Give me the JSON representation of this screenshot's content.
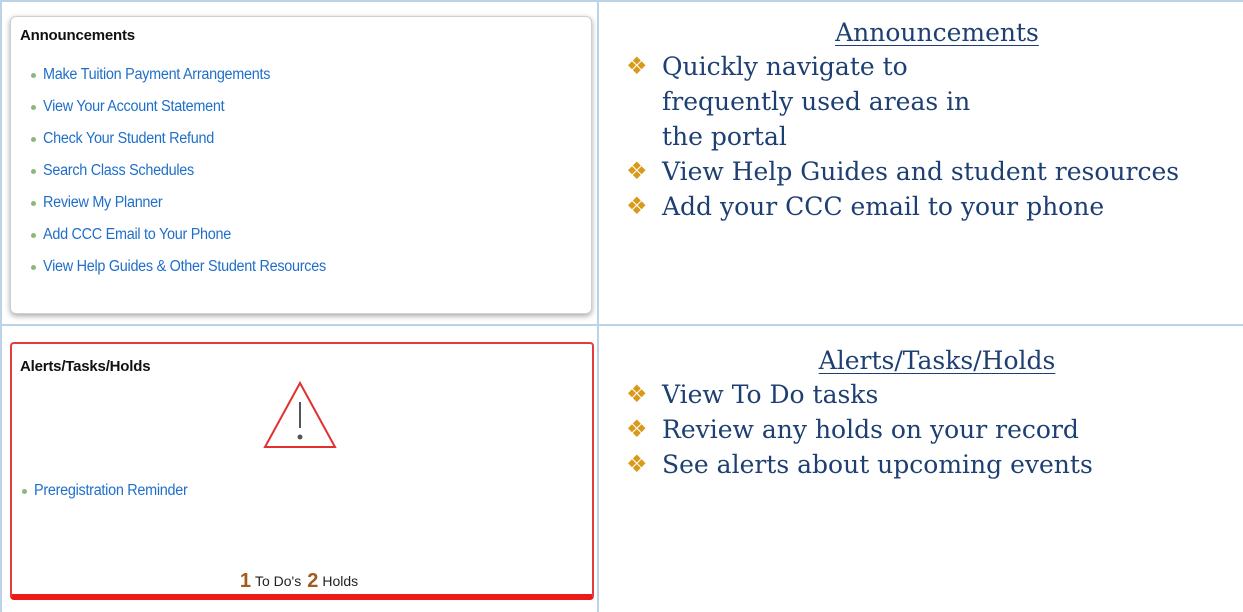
{
  "announcements_panel": {
    "title": "Announcements",
    "links": [
      "Make Tuition Payment Arrangements",
      "View Your Account Statement",
      "Check Your Student Refund",
      "Search Class Schedules",
      "Review My Planner",
      "Add CCC Email to Your Phone",
      "View Help Guides & Other Student Resources"
    ]
  },
  "alerts_panel": {
    "title": "Alerts/Tasks/Holds",
    "icon": "warning-triangle-icon",
    "link": "Preregistration Reminder",
    "todo_count": "1",
    "todo_label": "To Do's",
    "holds_count": "2",
    "holds_label": "Holds"
  },
  "announcements_desc": {
    "heading": "Announcements",
    "bullets": [
      "Quickly navigate to frequently used areas in the portal",
      "View Help Guides and student resources",
      "Add your CCC email to your phone"
    ]
  },
  "alerts_desc": {
    "heading": "Alerts/Tasks/Holds",
    "bullets": [
      "View To Do tasks",
      "Review any holds on your record",
      "See alerts about upcoming events"
    ]
  },
  "bullet_glyph": "❖",
  "colors": {
    "link": "#1f6fc9",
    "heading_text": "#1d3f72",
    "bullet_diamond": "#d99a1b",
    "alert_border": "#e53b3b",
    "count_number": "#a35a1e"
  }
}
